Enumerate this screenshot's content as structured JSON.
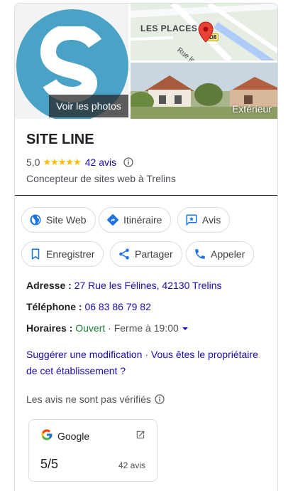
{
  "photos": {
    "main_button": "Voir les photos",
    "map_place_label": "LES PLACES",
    "map_road_label": "Rue les F",
    "map_road_badge": "D8",
    "exterior_label": "Extérieur"
  },
  "business": {
    "name": "SITE LINE",
    "rating": "5,0",
    "stars": "★★★★★",
    "reviews_count": "42 avis",
    "category": "Concepteur de sites web à Trelins"
  },
  "actions": [
    {
      "label": "Site Web",
      "icon": "globe-icon"
    },
    {
      "label": "Itinéraire",
      "icon": "directions-icon"
    },
    {
      "label": "Avis",
      "icon": "review-icon"
    },
    {
      "label": "Enregistrer",
      "icon": "bookmark-icon"
    },
    {
      "label": "Partager",
      "icon": "share-icon"
    },
    {
      "label": "Appeler",
      "icon": "phone-icon"
    }
  ],
  "details": {
    "address_label": "Adresse :",
    "address_value": "27 Rue les Félines, 42130 Trelins",
    "phone_label": "Téléphone :",
    "phone_value": "06 83 86 79 82",
    "hours_label": "Horaires :",
    "hours_status": "Ouvert",
    "hours_separator": "·",
    "hours_close": "Ferme à 19:00"
  },
  "suggest": {
    "edit": "Suggérer une modification",
    "separator": "·",
    "owner": "Vous êtes le propriétaire de cet établissement ?"
  },
  "unverified_text": "Les avis ne sont pas vérifiés",
  "google_card": {
    "source": "Google",
    "score": "5/5",
    "count": "42 avis"
  },
  "colors": {
    "logo_bg": "#4aa3c6",
    "link": "#1a0dab",
    "open": "#188038",
    "star": "#fbbc04"
  }
}
